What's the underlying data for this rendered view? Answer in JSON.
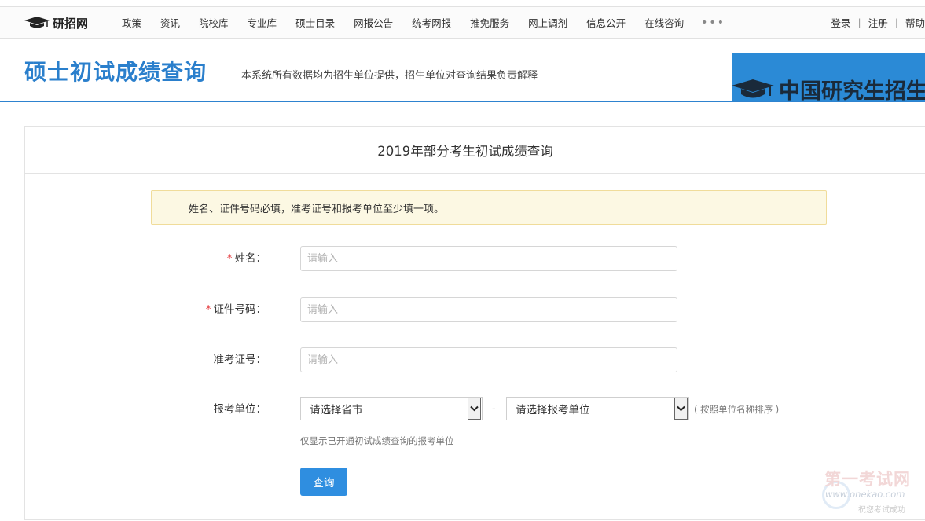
{
  "brand": {
    "logo_text": "研招网",
    "icon": "graduation-cap-icon"
  },
  "nav": {
    "items": [
      "政策",
      "资讯",
      "院校库",
      "专业库",
      "硕士目录",
      "网报公告",
      "统考网报",
      "推免服务",
      "网上调剂",
      "信息公开",
      "在线咨询"
    ],
    "more": "•••"
  },
  "auth": {
    "login": "登录",
    "register": "注册",
    "help": "帮助",
    "separator": "|"
  },
  "header": {
    "title": "硕士初试成绩查询",
    "subtitle": "本系统所有数据均为招生单位提供，招生单位对查询结果负责解释",
    "banner_text": "中国研究生招生"
  },
  "panel": {
    "title": "2019年部分考生初试成绩查询",
    "notice": "姓名、证件号码必填，准考证号和报考单位至少填一项。",
    "required_mark": "*",
    "fields": {
      "name": {
        "label": "姓名：",
        "placeholder": "请输入"
      },
      "id_number": {
        "label": "证件号码：",
        "placeholder": "请输入"
      },
      "exam_number": {
        "label": "准考证号：",
        "placeholder": "请输入"
      },
      "unit": {
        "label": "报考单位：",
        "province_select": "请选择省市",
        "dash": "-",
        "unit_select": "请选择报考单位",
        "sort_note": "( 按照单位名称排序 )"
      }
    },
    "hint": "仅显示已开通初试成绩查询的报考单位",
    "submit": "查询"
  },
  "watermark": {
    "line1": "第一考试网",
    "line2": "www.onekao.com",
    "line3": "祝您考试成功"
  },
  "colors": {
    "accent": "#2a7fcc",
    "button": "#2f8ee0",
    "notice_bg": "#fcf8e3",
    "required": "#e4393c"
  }
}
